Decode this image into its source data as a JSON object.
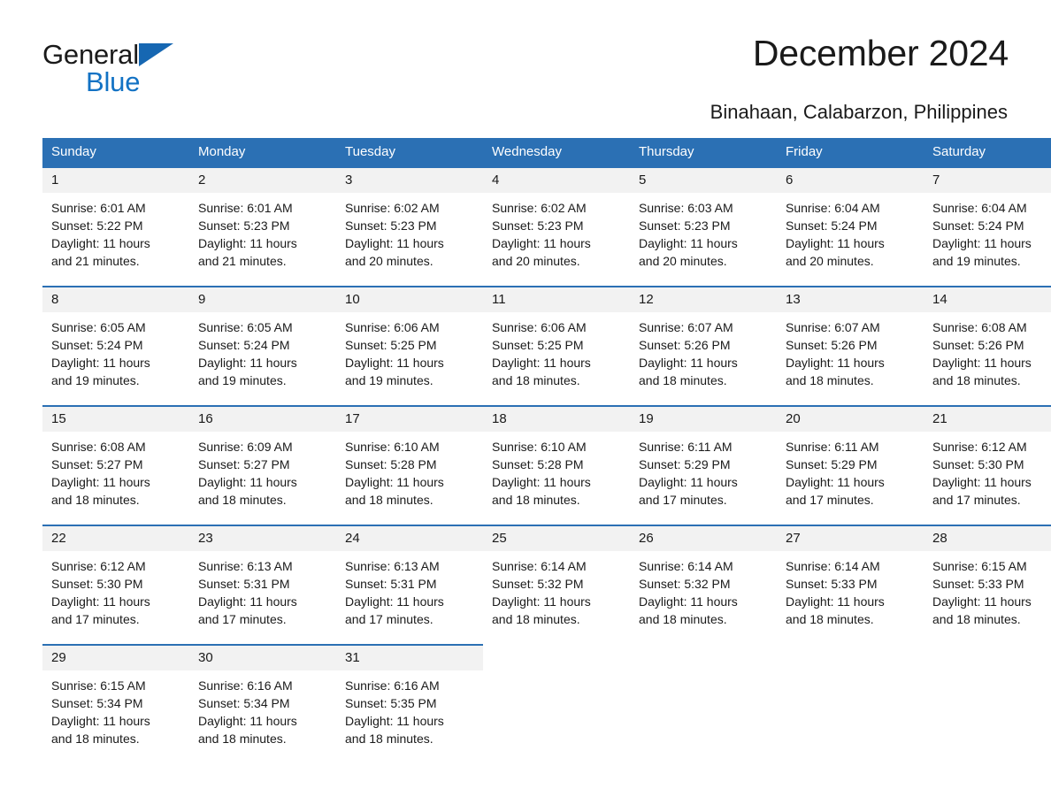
{
  "logo": {
    "word1": "General",
    "word2": "Blue",
    "triangle_color": "#1667b2",
    "blue_color": "#1272c4"
  },
  "header": {
    "title": "December 2024",
    "location": "Binahaan, Calabarzon, Philippines"
  },
  "theme": {
    "header_blue": "#2b70b4",
    "cell_gray": "#f2f2f2"
  },
  "weekday_headers": [
    "Sunday",
    "Monday",
    "Tuesday",
    "Wednesday",
    "Thursday",
    "Friday",
    "Saturday"
  ],
  "weeks": [
    [
      {
        "day": "1",
        "sunrise": "Sunrise: 6:01 AM",
        "sunset": "Sunset: 5:22 PM",
        "daylight1": "Daylight: 11 hours",
        "daylight2": "and 21 minutes."
      },
      {
        "day": "2",
        "sunrise": "Sunrise: 6:01 AM",
        "sunset": "Sunset: 5:23 PM",
        "daylight1": "Daylight: 11 hours",
        "daylight2": "and 21 minutes."
      },
      {
        "day": "3",
        "sunrise": "Sunrise: 6:02 AM",
        "sunset": "Sunset: 5:23 PM",
        "daylight1": "Daylight: 11 hours",
        "daylight2": "and 20 minutes."
      },
      {
        "day": "4",
        "sunrise": "Sunrise: 6:02 AM",
        "sunset": "Sunset: 5:23 PM",
        "daylight1": "Daylight: 11 hours",
        "daylight2": "and 20 minutes."
      },
      {
        "day": "5",
        "sunrise": "Sunrise: 6:03 AM",
        "sunset": "Sunset: 5:23 PM",
        "daylight1": "Daylight: 11 hours",
        "daylight2": "and 20 minutes."
      },
      {
        "day": "6",
        "sunrise": "Sunrise: 6:04 AM",
        "sunset": "Sunset: 5:24 PM",
        "daylight1": "Daylight: 11 hours",
        "daylight2": "and 20 minutes."
      },
      {
        "day": "7",
        "sunrise": "Sunrise: 6:04 AM",
        "sunset": "Sunset: 5:24 PM",
        "daylight1": "Daylight: 11 hours",
        "daylight2": "and 19 minutes."
      }
    ],
    [
      {
        "day": "8",
        "sunrise": "Sunrise: 6:05 AM",
        "sunset": "Sunset: 5:24 PM",
        "daylight1": "Daylight: 11 hours",
        "daylight2": "and 19 minutes."
      },
      {
        "day": "9",
        "sunrise": "Sunrise: 6:05 AM",
        "sunset": "Sunset: 5:24 PM",
        "daylight1": "Daylight: 11 hours",
        "daylight2": "and 19 minutes."
      },
      {
        "day": "10",
        "sunrise": "Sunrise: 6:06 AM",
        "sunset": "Sunset: 5:25 PM",
        "daylight1": "Daylight: 11 hours",
        "daylight2": "and 19 minutes."
      },
      {
        "day": "11",
        "sunrise": "Sunrise: 6:06 AM",
        "sunset": "Sunset: 5:25 PM",
        "daylight1": "Daylight: 11 hours",
        "daylight2": "and 18 minutes."
      },
      {
        "day": "12",
        "sunrise": "Sunrise: 6:07 AM",
        "sunset": "Sunset: 5:26 PM",
        "daylight1": "Daylight: 11 hours",
        "daylight2": "and 18 minutes."
      },
      {
        "day": "13",
        "sunrise": "Sunrise: 6:07 AM",
        "sunset": "Sunset: 5:26 PM",
        "daylight1": "Daylight: 11 hours",
        "daylight2": "and 18 minutes."
      },
      {
        "day": "14",
        "sunrise": "Sunrise: 6:08 AM",
        "sunset": "Sunset: 5:26 PM",
        "daylight1": "Daylight: 11 hours",
        "daylight2": "and 18 minutes."
      }
    ],
    [
      {
        "day": "15",
        "sunrise": "Sunrise: 6:08 AM",
        "sunset": "Sunset: 5:27 PM",
        "daylight1": "Daylight: 11 hours",
        "daylight2": "and 18 minutes."
      },
      {
        "day": "16",
        "sunrise": "Sunrise: 6:09 AM",
        "sunset": "Sunset: 5:27 PM",
        "daylight1": "Daylight: 11 hours",
        "daylight2": "and 18 minutes."
      },
      {
        "day": "17",
        "sunrise": "Sunrise: 6:10 AM",
        "sunset": "Sunset: 5:28 PM",
        "daylight1": "Daylight: 11 hours",
        "daylight2": "and 18 minutes."
      },
      {
        "day": "18",
        "sunrise": "Sunrise: 6:10 AM",
        "sunset": "Sunset: 5:28 PM",
        "daylight1": "Daylight: 11 hours",
        "daylight2": "and 18 minutes."
      },
      {
        "day": "19",
        "sunrise": "Sunrise: 6:11 AM",
        "sunset": "Sunset: 5:29 PM",
        "daylight1": "Daylight: 11 hours",
        "daylight2": "and 17 minutes."
      },
      {
        "day": "20",
        "sunrise": "Sunrise: 6:11 AM",
        "sunset": "Sunset: 5:29 PM",
        "daylight1": "Daylight: 11 hours",
        "daylight2": "and 17 minutes."
      },
      {
        "day": "21",
        "sunrise": "Sunrise: 6:12 AM",
        "sunset": "Sunset: 5:30 PM",
        "daylight1": "Daylight: 11 hours",
        "daylight2": "and 17 minutes."
      }
    ],
    [
      {
        "day": "22",
        "sunrise": "Sunrise: 6:12 AM",
        "sunset": "Sunset: 5:30 PM",
        "daylight1": "Daylight: 11 hours",
        "daylight2": "and 17 minutes."
      },
      {
        "day": "23",
        "sunrise": "Sunrise: 6:13 AM",
        "sunset": "Sunset: 5:31 PM",
        "daylight1": "Daylight: 11 hours",
        "daylight2": "and 17 minutes."
      },
      {
        "day": "24",
        "sunrise": "Sunrise: 6:13 AM",
        "sunset": "Sunset: 5:31 PM",
        "daylight1": "Daylight: 11 hours",
        "daylight2": "and 17 minutes."
      },
      {
        "day": "25",
        "sunrise": "Sunrise: 6:14 AM",
        "sunset": "Sunset: 5:32 PM",
        "daylight1": "Daylight: 11 hours",
        "daylight2": "and 18 minutes."
      },
      {
        "day": "26",
        "sunrise": "Sunrise: 6:14 AM",
        "sunset": "Sunset: 5:32 PM",
        "daylight1": "Daylight: 11 hours",
        "daylight2": "and 18 minutes."
      },
      {
        "day": "27",
        "sunrise": "Sunrise: 6:14 AM",
        "sunset": "Sunset: 5:33 PM",
        "daylight1": "Daylight: 11 hours",
        "daylight2": "and 18 minutes."
      },
      {
        "day": "28",
        "sunrise": "Sunrise: 6:15 AM",
        "sunset": "Sunset: 5:33 PM",
        "daylight1": "Daylight: 11 hours",
        "daylight2": "and 18 minutes."
      }
    ],
    [
      {
        "day": "29",
        "sunrise": "Sunrise: 6:15 AM",
        "sunset": "Sunset: 5:34 PM",
        "daylight1": "Daylight: 11 hours",
        "daylight2": "and 18 minutes."
      },
      {
        "day": "30",
        "sunrise": "Sunrise: 6:16 AM",
        "sunset": "Sunset: 5:34 PM",
        "daylight1": "Daylight: 11 hours",
        "daylight2": "and 18 minutes."
      },
      {
        "day": "31",
        "sunrise": "Sunrise: 6:16 AM",
        "sunset": "Sunset: 5:35 PM",
        "daylight1": "Daylight: 11 hours",
        "daylight2": "and 18 minutes."
      },
      {
        "day": "",
        "sunrise": "",
        "sunset": "",
        "daylight1": "",
        "daylight2": ""
      },
      {
        "day": "",
        "sunrise": "",
        "sunset": "",
        "daylight1": "",
        "daylight2": ""
      },
      {
        "day": "",
        "sunrise": "",
        "sunset": "",
        "daylight1": "",
        "daylight2": ""
      },
      {
        "day": "",
        "sunrise": "",
        "sunset": "",
        "daylight1": "",
        "daylight2": ""
      }
    ]
  ]
}
